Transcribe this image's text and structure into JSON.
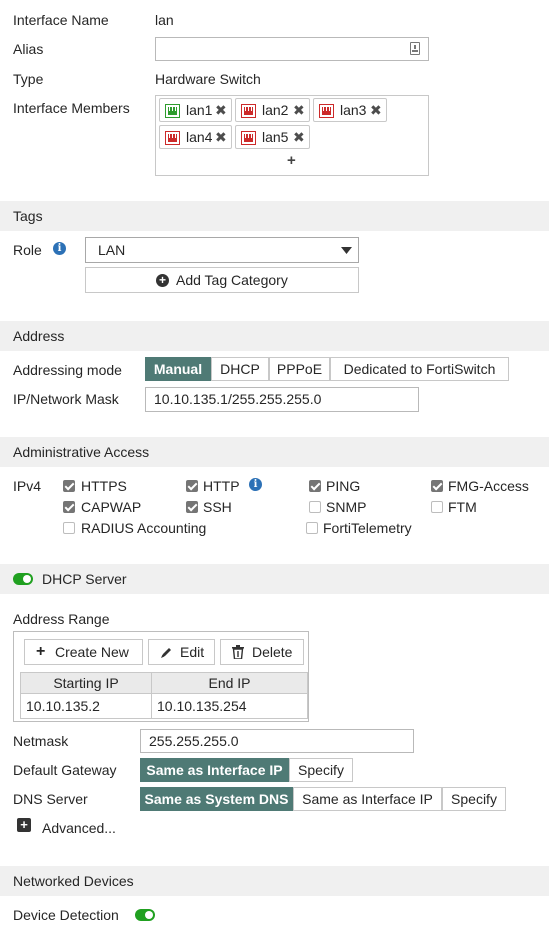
{
  "interface": {
    "name_label": "Interface Name",
    "name_value": "lan",
    "alias_label": "Alias",
    "alias_value": "",
    "type_label": "Type",
    "type_value": "Hardware Switch",
    "members_label": "Interface Members",
    "members": [
      {
        "label": "lan1",
        "status": "up",
        "remove": "✖"
      },
      {
        "label": "lan2",
        "status": "down",
        "remove": "✖"
      },
      {
        "label": "lan3",
        "status": "down",
        "remove": "✖"
      },
      {
        "label": "lan4",
        "status": "down",
        "remove": "✖"
      },
      {
        "label": "lan5",
        "status": "down",
        "remove": "✖"
      }
    ],
    "add_member": "+"
  },
  "tags": {
    "section_title": "Tags",
    "role_label": "Role",
    "role_value": "LAN",
    "add_tag_label": "Add Tag Category"
  },
  "address": {
    "section_title": "Address",
    "mode_label": "Addressing mode",
    "modes": [
      "Manual",
      "DHCP",
      "PPPoE",
      "Dedicated to FortiSwitch"
    ],
    "selected_mode": "Manual",
    "ip_label": "IP/Network Mask",
    "ip_value": "10.10.135.1/255.255.255.0"
  },
  "admin_access": {
    "section_title": "Administrative Access",
    "ipv4_label": "IPv4",
    "options": [
      {
        "label": "HTTPS",
        "checked": true
      },
      {
        "label": "HTTP",
        "checked": true
      },
      {
        "label": "PING",
        "checked": true
      },
      {
        "label": "FMG-Access",
        "checked": true
      },
      {
        "label": "CAPWAP",
        "checked": true
      },
      {
        "label": "SSH",
        "checked": true
      },
      {
        "label": "SNMP",
        "checked": false
      },
      {
        "label": "FTM",
        "checked": false
      },
      {
        "label": "RADIUS Accounting",
        "checked": false
      },
      {
        "label": "FortiTelemetry",
        "checked": false
      }
    ]
  },
  "dhcp": {
    "section_title": "DHCP Server",
    "enabled": true,
    "address_range_label": "Address Range",
    "create_new_label": "Create New",
    "edit_label": "Edit",
    "delete_label": "Delete",
    "table": {
      "columns": [
        "Starting IP",
        "End IP"
      ],
      "rows": [
        [
          "10.10.135.2",
          "10.10.135.254"
        ]
      ]
    },
    "netmask_label": "Netmask",
    "netmask_value": "255.255.255.0",
    "gateway_label": "Default Gateway",
    "gateway_options": [
      "Same as Interface IP",
      "Specify"
    ],
    "gateway_selected": "Same as Interface IP",
    "dns_label": "DNS Server",
    "dns_options": [
      "Same as System DNS",
      "Same as Interface IP",
      "Specify"
    ],
    "dns_selected": "Same as System DNS",
    "advanced_label": "Advanced..."
  },
  "networked_devices": {
    "section_title": "Networked Devices",
    "device_detection_label": "Device Detection",
    "device_detection_enabled": true
  },
  "colors": {
    "accent": "#4f7a75",
    "toggle_on": "#20a020",
    "info_icon": "#2c71b6",
    "port_up": "#2e9c2e",
    "port_down": "#cc2a2a",
    "section_bg": "#f0f0f0"
  }
}
